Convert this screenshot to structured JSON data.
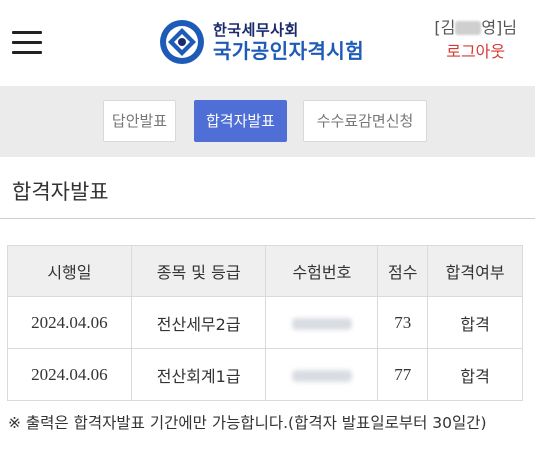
{
  "header": {
    "logo_sub": "한국세무사회",
    "logo_main": "국가공인자격시험",
    "user_prefix": "[김",
    "user_suffix": "영]님",
    "logout_label": "로그아웃"
  },
  "tabs": [
    {
      "label": "답안발표",
      "active": false
    },
    {
      "label": "합격자발표",
      "active": true
    },
    {
      "label": "수수료감면신청",
      "active": false
    }
  ],
  "page_title": "합격자발표",
  "table": {
    "headers": [
      "시행일",
      "종목 및 등급",
      "수험번호",
      "점수",
      "합격여부"
    ],
    "rows": [
      {
        "date": "2024.04.06",
        "subject": "전산세무2급",
        "exam_no": "",
        "score": "73",
        "result": "합격"
      },
      {
        "date": "2024.04.06",
        "subject": "전산회계1급",
        "exam_no": "",
        "score": "77",
        "result": "합격"
      }
    ]
  },
  "notice": "※ 출력은 합격자발표 기간에만 가능합니다.(합격자 발표일로부터 30일간)",
  "colors": {
    "accent": "#4f6fd6",
    "logout": "#d83a32",
    "logo_blue": "#1e5bb8"
  }
}
